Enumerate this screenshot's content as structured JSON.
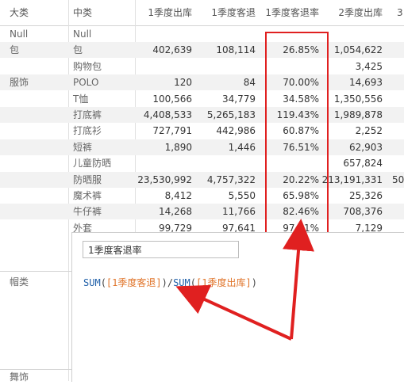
{
  "headers": [
    "大类",
    "中类",
    "1季度出库",
    "1季度客退",
    "1季度客退率",
    "2季度出库",
    "3"
  ],
  "rows": [
    {
      "cat": "Null",
      "sub": "Null",
      "c1": "",
      "c2": "",
      "c3": "",
      "c4": ""
    },
    {
      "cat": "包",
      "sub": "包",
      "c1": "402,639",
      "c2": "108,114",
      "c3": "26.85%",
      "c4": "1,054,622"
    },
    {
      "cat": "",
      "sub": "购物包",
      "c1": "",
      "c2": "",
      "c3": "",
      "c4": "3,425"
    },
    {
      "cat": "服饰",
      "sub": "POLO",
      "c1": "120",
      "c2": "84",
      "c3": "70.00%",
      "c4": "14,693"
    },
    {
      "cat": "",
      "sub": "T恤",
      "c1": "100,566",
      "c2": "34,779",
      "c3": "34.58%",
      "c4": "1,350,556"
    },
    {
      "cat": "",
      "sub": "打底裤",
      "c1": "4,408,533",
      "c2": "5,265,183",
      "c3": "119.43%",
      "c4": "1,989,878"
    },
    {
      "cat": "",
      "sub": "打底衫",
      "c1": "727,791",
      "c2": "442,986",
      "c3": "60.87%",
      "c4": "2,252"
    },
    {
      "cat": "",
      "sub": "短裤",
      "c1": "1,890",
      "c2": "1,446",
      "c3": "76.51%",
      "c4": "62,903"
    },
    {
      "cat": "",
      "sub": "儿童防晒",
      "c1": "",
      "c2": "",
      "c3": "",
      "c4": "657,824"
    },
    {
      "cat": "",
      "sub": "防晒服",
      "c1": "23,530,992",
      "c2": "4,757,322",
      "c3": "20.22%",
      "c4": "213,191,331"
    },
    {
      "cat": "",
      "sub": "魔术裤",
      "c1": "8,412",
      "c2": "5,550",
      "c3": "65.98%",
      "c4": "25,326"
    },
    {
      "cat": "",
      "sub": "牛仔裤",
      "c1": "14,268",
      "c2": "11,766",
      "c3": "82.46%",
      "c4": "708,376"
    },
    {
      "cat": "",
      "sub": "外套",
      "c1": "99,729",
      "c2": "97,641",
      "c3": "97.91%",
      "c4": "7,129"
    }
  ],
  "partial_c5_row9": "50",
  "left_labels": {
    "hat": "帽类",
    "other": "舞饰"
  },
  "editor": {
    "name_value": "1季度客退率",
    "formula": {
      "fn1": "SUM",
      "open1": "(",
      "field1": "[1季度客退]",
      "close1": ")",
      "div": "/",
      "fn2": "SUM",
      "open2": "(",
      "field2": "[1季度出库]",
      "close2": ")"
    }
  },
  "highlight_color": "#e02020"
}
